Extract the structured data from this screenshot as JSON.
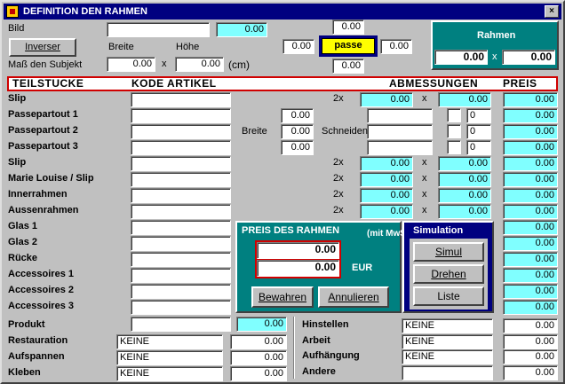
{
  "title": "DEFINITION DEN RAHMEN",
  "close": "×",
  "header": {
    "bild_label": "Bild",
    "bild_value": "",
    "bild_num": "0.00",
    "inverser": "Inverser",
    "breite_label": "Breite",
    "hoehe_label": "Höhe",
    "mass_label": "Maß den Subjekt",
    "breite_value": "0.00",
    "x": "x",
    "hoehe_value": "0.00",
    "unit": "(cm)",
    "top_center": "0.00",
    "left_center": "0.00",
    "passe": "passe",
    "right_center": "0.00",
    "bottom_center": "0.00"
  },
  "rahmen": {
    "label": "Rahmen",
    "v1": "0.00",
    "x": "x",
    "v2": "0.00"
  },
  "columns": {
    "teil": "TEILSTUCKE",
    "kode": "KODE ARTIKEL",
    "abm": "ABMESSUNGEN",
    "preis": "PREIS"
  },
  "rows": [
    {
      "label": "Slip",
      "kode": "",
      "mult": "2x",
      "a": "0.00",
      "x": "x",
      "b": "0.00",
      "preis": "0.00"
    },
    {
      "label": "Passepartout 1",
      "kode": "",
      "pp": "0.00",
      "chk": "0",
      "preis": "0.00"
    },
    {
      "label": "Passepartout 2",
      "kode": "",
      "pp": "0.00",
      "chk": "0",
      "preis": "0.00"
    },
    {
      "label": "Passepartout 3",
      "kode": "",
      "pp": "0.00",
      "chk": "0",
      "preis": "0.00"
    },
    {
      "label": "Slip",
      "kode": "",
      "mult": "2x",
      "a": "0.00",
      "x": "x",
      "b": "0.00",
      "preis": "0.00"
    },
    {
      "label": "Marie Louise / Slip",
      "kode": "",
      "mult": "2x",
      "a": "0.00",
      "x": "x",
      "b": "0.00",
      "preis": "0.00"
    },
    {
      "label": "Innerrahmen",
      "kode": "",
      "mult": "2x",
      "a": "0.00",
      "x": "x",
      "b": "0.00",
      "preis": "0.00"
    },
    {
      "label": "Aussenrahmen",
      "kode": "",
      "mult": "2x",
      "a": "0.00",
      "x": "x",
      "b": "0.00",
      "preis": "0.00"
    },
    {
      "label": "Glas 1",
      "kode": "",
      "preis": "0.00"
    },
    {
      "label": "Glas 2",
      "kode": "",
      "preis": "0.00"
    },
    {
      "label": "Rücke",
      "kode": "",
      "preis": "0.00"
    },
    {
      "label": "Accessoires 1",
      "kode": "",
      "preis": "0.00"
    },
    {
      "label": "Accessoires 2",
      "kode": "",
      "preis": "0.00"
    },
    {
      "label": "Accessoires 3",
      "kode": "",
      "preis": "0.00"
    }
  ],
  "pp_breite": "Breite",
  "pp_schneiden": "Schneiden",
  "produkt": {
    "label": "Produkt",
    "value": "0.00"
  },
  "preis_panel": {
    "title": "PREIS DES RAHMEN",
    "mit": "(mit MwSt)",
    "v1": "0.00",
    "v2": "0.00",
    "eur": "EUR",
    "bewahren": "Bewahren",
    "annulieren": "Annulieren"
  },
  "simulation": {
    "title": "Simulation",
    "simul": "Simul",
    "drehen": "Drehen",
    "liste": "Liste"
  },
  "bottom_left": [
    {
      "label": "Restauration",
      "value": "KEINE",
      "num": "0.00"
    },
    {
      "label": "Aufspannen",
      "value": "KEINE",
      "num": "0.00"
    },
    {
      "label": "Kleben",
      "value": "KEINE",
      "num": "0.00"
    }
  ],
  "bottom_right": [
    {
      "label": "Hinstellen",
      "value": "KEINE",
      "num": "0.00"
    },
    {
      "label": "Arbeit",
      "value": "KEINE",
      "num": "0.00"
    },
    {
      "label": "Aufhängung",
      "value": "KEINE",
      "num": "0.00"
    },
    {
      "label": "Andere",
      "value": "",
      "num": "0.00"
    }
  ]
}
